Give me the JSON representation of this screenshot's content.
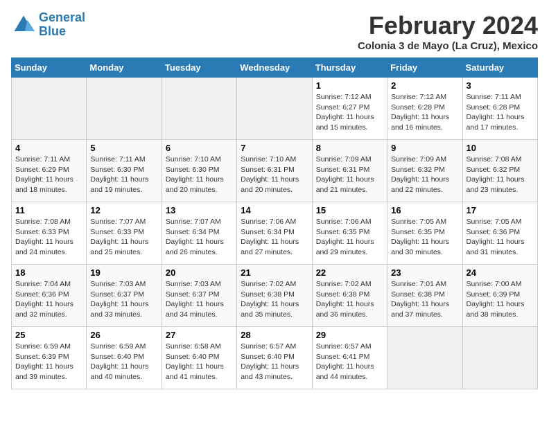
{
  "logo": {
    "line1": "General",
    "line2": "Blue"
  },
  "title": "February 2024",
  "subtitle": "Colonia 3 de Mayo (La Cruz), Mexico",
  "days_of_week": [
    "Sunday",
    "Monday",
    "Tuesday",
    "Wednesday",
    "Thursday",
    "Friday",
    "Saturday"
  ],
  "weeks": [
    [
      {
        "day": "",
        "sunrise": "",
        "sunset": "",
        "daylight": ""
      },
      {
        "day": "",
        "sunrise": "",
        "sunset": "",
        "daylight": ""
      },
      {
        "day": "",
        "sunrise": "",
        "sunset": "",
        "daylight": ""
      },
      {
        "day": "",
        "sunrise": "",
        "sunset": "",
        "daylight": ""
      },
      {
        "day": "1",
        "sunrise": "Sunrise: 7:12 AM",
        "sunset": "Sunset: 6:27 PM",
        "daylight": "Daylight: 11 hours and 15 minutes."
      },
      {
        "day": "2",
        "sunrise": "Sunrise: 7:12 AM",
        "sunset": "Sunset: 6:28 PM",
        "daylight": "Daylight: 11 hours and 16 minutes."
      },
      {
        "day": "3",
        "sunrise": "Sunrise: 7:11 AM",
        "sunset": "Sunset: 6:28 PM",
        "daylight": "Daylight: 11 hours and 17 minutes."
      }
    ],
    [
      {
        "day": "4",
        "sunrise": "Sunrise: 7:11 AM",
        "sunset": "Sunset: 6:29 PM",
        "daylight": "Daylight: 11 hours and 18 minutes."
      },
      {
        "day": "5",
        "sunrise": "Sunrise: 7:11 AM",
        "sunset": "Sunset: 6:30 PM",
        "daylight": "Daylight: 11 hours and 19 minutes."
      },
      {
        "day": "6",
        "sunrise": "Sunrise: 7:10 AM",
        "sunset": "Sunset: 6:30 PM",
        "daylight": "Daylight: 11 hours and 20 minutes."
      },
      {
        "day": "7",
        "sunrise": "Sunrise: 7:10 AM",
        "sunset": "Sunset: 6:31 PM",
        "daylight": "Daylight: 11 hours and 20 minutes."
      },
      {
        "day": "8",
        "sunrise": "Sunrise: 7:09 AM",
        "sunset": "Sunset: 6:31 PM",
        "daylight": "Daylight: 11 hours and 21 minutes."
      },
      {
        "day": "9",
        "sunrise": "Sunrise: 7:09 AM",
        "sunset": "Sunset: 6:32 PM",
        "daylight": "Daylight: 11 hours and 22 minutes."
      },
      {
        "day": "10",
        "sunrise": "Sunrise: 7:08 AM",
        "sunset": "Sunset: 6:32 PM",
        "daylight": "Daylight: 11 hours and 23 minutes."
      }
    ],
    [
      {
        "day": "11",
        "sunrise": "Sunrise: 7:08 AM",
        "sunset": "Sunset: 6:33 PM",
        "daylight": "Daylight: 11 hours and 24 minutes."
      },
      {
        "day": "12",
        "sunrise": "Sunrise: 7:07 AM",
        "sunset": "Sunset: 6:33 PM",
        "daylight": "Daylight: 11 hours and 25 minutes."
      },
      {
        "day": "13",
        "sunrise": "Sunrise: 7:07 AM",
        "sunset": "Sunset: 6:34 PM",
        "daylight": "Daylight: 11 hours and 26 minutes."
      },
      {
        "day": "14",
        "sunrise": "Sunrise: 7:06 AM",
        "sunset": "Sunset: 6:34 PM",
        "daylight": "Daylight: 11 hours and 27 minutes."
      },
      {
        "day": "15",
        "sunrise": "Sunrise: 7:06 AM",
        "sunset": "Sunset: 6:35 PM",
        "daylight": "Daylight: 11 hours and 29 minutes."
      },
      {
        "day": "16",
        "sunrise": "Sunrise: 7:05 AM",
        "sunset": "Sunset: 6:35 PM",
        "daylight": "Daylight: 11 hours and 30 minutes."
      },
      {
        "day": "17",
        "sunrise": "Sunrise: 7:05 AM",
        "sunset": "Sunset: 6:36 PM",
        "daylight": "Daylight: 11 hours and 31 minutes."
      }
    ],
    [
      {
        "day": "18",
        "sunrise": "Sunrise: 7:04 AM",
        "sunset": "Sunset: 6:36 PM",
        "daylight": "Daylight: 11 hours and 32 minutes."
      },
      {
        "day": "19",
        "sunrise": "Sunrise: 7:03 AM",
        "sunset": "Sunset: 6:37 PM",
        "daylight": "Daylight: 11 hours and 33 minutes."
      },
      {
        "day": "20",
        "sunrise": "Sunrise: 7:03 AM",
        "sunset": "Sunset: 6:37 PM",
        "daylight": "Daylight: 11 hours and 34 minutes."
      },
      {
        "day": "21",
        "sunrise": "Sunrise: 7:02 AM",
        "sunset": "Sunset: 6:38 PM",
        "daylight": "Daylight: 11 hours and 35 minutes."
      },
      {
        "day": "22",
        "sunrise": "Sunrise: 7:02 AM",
        "sunset": "Sunset: 6:38 PM",
        "daylight": "Daylight: 11 hours and 36 minutes."
      },
      {
        "day": "23",
        "sunrise": "Sunrise: 7:01 AM",
        "sunset": "Sunset: 6:38 PM",
        "daylight": "Daylight: 11 hours and 37 minutes."
      },
      {
        "day": "24",
        "sunrise": "Sunrise: 7:00 AM",
        "sunset": "Sunset: 6:39 PM",
        "daylight": "Daylight: 11 hours and 38 minutes."
      }
    ],
    [
      {
        "day": "25",
        "sunrise": "Sunrise: 6:59 AM",
        "sunset": "Sunset: 6:39 PM",
        "daylight": "Daylight: 11 hours and 39 minutes."
      },
      {
        "day": "26",
        "sunrise": "Sunrise: 6:59 AM",
        "sunset": "Sunset: 6:40 PM",
        "daylight": "Daylight: 11 hours and 40 minutes."
      },
      {
        "day": "27",
        "sunrise": "Sunrise: 6:58 AM",
        "sunset": "Sunset: 6:40 PM",
        "daylight": "Daylight: 11 hours and 41 minutes."
      },
      {
        "day": "28",
        "sunrise": "Sunrise: 6:57 AM",
        "sunset": "Sunset: 6:40 PM",
        "daylight": "Daylight: 11 hours and 43 minutes."
      },
      {
        "day": "29",
        "sunrise": "Sunrise: 6:57 AM",
        "sunset": "Sunset: 6:41 PM",
        "daylight": "Daylight: 11 hours and 44 minutes."
      },
      {
        "day": "",
        "sunrise": "",
        "sunset": "",
        "daylight": ""
      },
      {
        "day": "",
        "sunrise": "",
        "sunset": "",
        "daylight": ""
      }
    ]
  ]
}
